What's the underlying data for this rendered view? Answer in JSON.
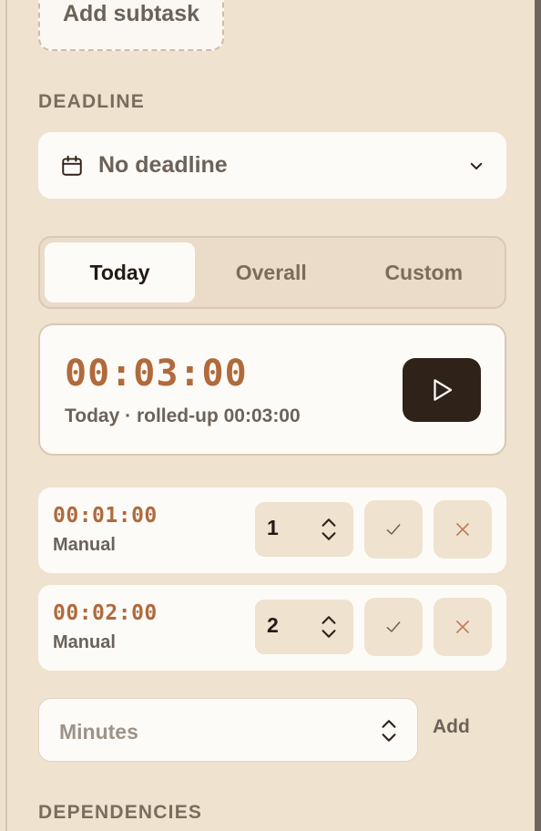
{
  "subtasks": {
    "add_label": "Add subtask"
  },
  "deadline": {
    "section_label": "DEADLINE",
    "selected_value": "No deadline",
    "icon": "calendar-icon"
  },
  "tabs": [
    {
      "label": "Today",
      "active": true
    },
    {
      "label": "Overall",
      "active": false
    },
    {
      "label": "Custom",
      "active": false
    }
  ],
  "timer": {
    "time": "00:03:00",
    "subtitle": "Today · rolled-up 00:03:00",
    "play_icon": "play-icon"
  },
  "entries": [
    {
      "time": "00:01:00",
      "type": "Manual",
      "value": "1"
    },
    {
      "time": "00:02:00",
      "type": "Manual",
      "value": "2"
    }
  ],
  "add_time": {
    "placeholder": "Minutes",
    "button_label": "Add"
  },
  "dependencies": {
    "section_label": "DEPENDENCIES"
  },
  "colors": {
    "background": "#efe2cf",
    "card": "#fdfbf7",
    "accent_time": "#b06a3c",
    "play_button": "#2e2219",
    "delete_x": "#c27a55"
  }
}
